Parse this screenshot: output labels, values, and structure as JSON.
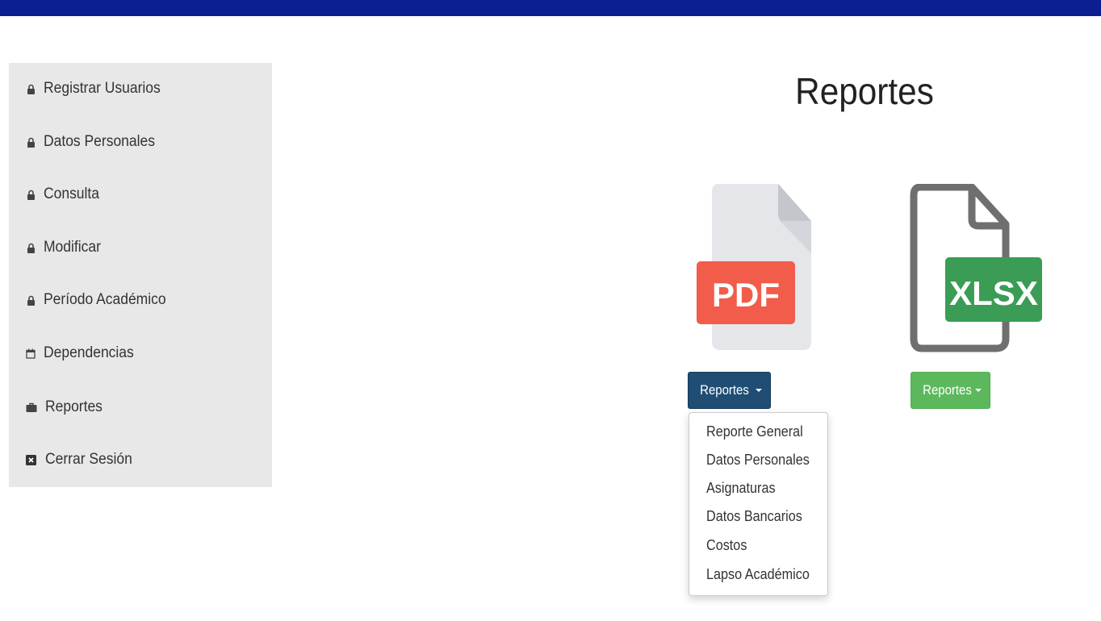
{
  "colors": {
    "top_bar": "#0b1f91",
    "sidebar_bg": "#e8e8e8",
    "pdf_button": "#1f4d74",
    "xlsx_button": "#5cb85c",
    "pdf_badge": "#f25c4a",
    "xlsx_badge": "#3a9c55"
  },
  "sidebar": {
    "items": [
      {
        "label": "Registrar Usuarios",
        "icon": "lock-icon"
      },
      {
        "label": "Datos Personales",
        "icon": "lock-icon"
      },
      {
        "label": "Consulta",
        "icon": "lock-icon"
      },
      {
        "label": "Modificar",
        "icon": "lock-icon"
      },
      {
        "label": "Período Académico",
        "icon": "lock-icon"
      },
      {
        "label": "Dependencias",
        "icon": "calendar-icon"
      },
      {
        "label": "Reportes",
        "icon": "briefcase-icon"
      },
      {
        "label": "Cerrar Sesión",
        "icon": "close-box-icon"
      }
    ]
  },
  "main": {
    "title": "Reportes",
    "pdf": {
      "badge": "PDF",
      "button_label": "Reportes",
      "dropdown": [
        "Reporte General",
        "Datos Personales",
        "Asignaturas",
        "Datos Bancarios",
        "Costos",
        "Lapso Académico"
      ]
    },
    "xlsx": {
      "badge": "XLSX",
      "button_label": "Reportes"
    }
  }
}
